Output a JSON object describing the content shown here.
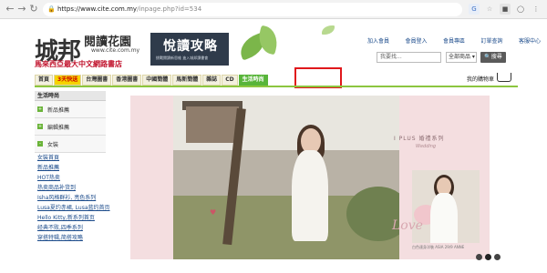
{
  "browser": {
    "url_host": "https://www.cite.com.my",
    "url_path": "/inpage.php?id=534",
    "lock_icon": "lock-icon"
  },
  "header": {
    "logo_main": "城邦",
    "logo_sub": "閱讀花園",
    "logo_url": "www.cite.com.my",
    "logo_tag": "馬來西亞最大中文網路書店",
    "banner_title": "悅讀攻略",
    "banner_sub": "挑戰閱讀新思維 進入城邦讀書會",
    "top_links": [
      "加入會員",
      "會員登入",
      "會員專區",
      "訂單查詢",
      "客服中心"
    ],
    "search_placeholder": "我要找...",
    "search_category": "全部商品",
    "search_button": "搜尋",
    "cart_label": "我的購物車"
  },
  "nav": {
    "tabs": [
      "首頁",
      "3天快送",
      "台灣圖書",
      "香港圖書",
      "中國簡體",
      "馬新簡體",
      "雜誌",
      "CD",
      "生活時尚"
    ]
  },
  "sidebar": {
    "title": "生活時尚",
    "boxes": [
      "新品推薦",
      "編輯推薦",
      "女裝"
    ],
    "links": [
      "女裝首頁",
      "新品推薦",
      "HOT热卖",
      "热卖商品补货到",
      "Isha风格群衫, 亮色系列",
      "Lusa夏约赤裙, Lusa蓝约首页",
      "Hello Kitty,新系列首页",
      "经典不败,四季系列",
      "穿搭特辑,简搭攻略"
    ]
  },
  "hero": {
    "brand_line": "I PLUS 婚禮系列",
    "brand_sub": "Wedding",
    "right_caption": "白色連身洋裝 ASIA 29/9 ANNE",
    "cursive": "Love"
  }
}
